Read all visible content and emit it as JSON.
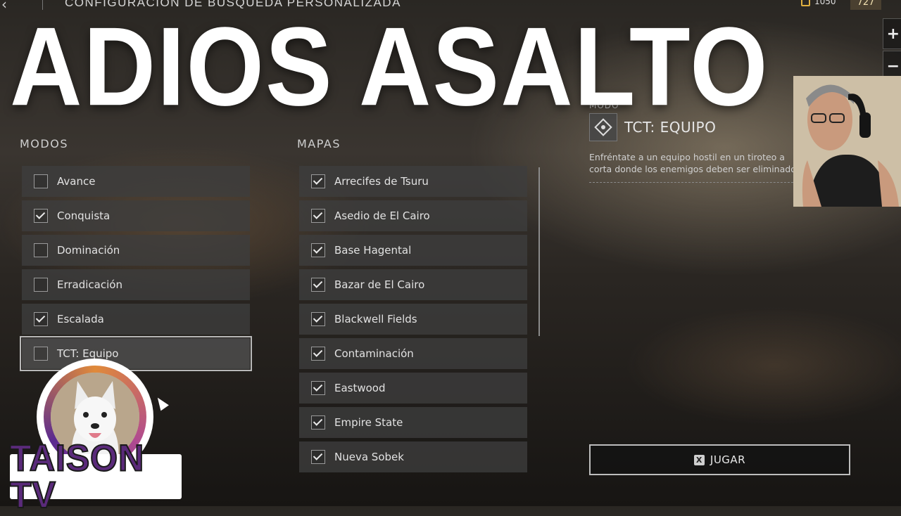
{
  "header": {
    "title": "CONFIGURACIÓN DE BÚSQUEDA PERSONALIZADA",
    "currency_value": "1050",
    "level_value": "727"
  },
  "right_rail": [
    {
      "name": "plus",
      "glyph": "+"
    },
    {
      "name": "minus",
      "glyph": "−"
    },
    {
      "name": "party",
      "glyph": "👥"
    },
    {
      "name": "exit",
      "glyph": "⇥"
    }
  ],
  "overlay": {
    "headline": "ADIOS ASALTO",
    "channel_name": "TAISON TV"
  },
  "modes": {
    "header": "MODOS",
    "items": [
      {
        "label": "Avance",
        "checked": false
      },
      {
        "label": "Conquista",
        "checked": true
      },
      {
        "label": "Dominación",
        "checked": false
      },
      {
        "label": "Erradicación",
        "checked": false
      },
      {
        "label": "Escalada",
        "checked": true
      },
      {
        "label": "TCT: Equipo",
        "checked": false,
        "selected": true
      }
    ]
  },
  "maps": {
    "header": "MAPAS",
    "items": [
      {
        "label": "Arrecifes de Tsuru",
        "checked": true
      },
      {
        "label": "Asedio de El Cairo",
        "checked": true
      },
      {
        "label": "Base Hagental",
        "checked": true
      },
      {
        "label": "Bazar de El Cairo",
        "checked": true
      },
      {
        "label": "Blackwell Fields",
        "checked": true
      },
      {
        "label": "Contaminación",
        "checked": true
      },
      {
        "label": "Eastwood",
        "checked": true
      },
      {
        "label": "Empire State",
        "checked": true
      },
      {
        "label": "Nueva Sobek",
        "checked": true
      }
    ]
  },
  "mode_detail": {
    "caption": "MODO",
    "name": "TCT: EQUIPO",
    "description": "Enfréntate a un equipo hostil en un tiroteo a corta donde los enemigos deben ser eliminados."
  },
  "play_button": {
    "key": "X",
    "label": "JUGAR"
  },
  "colors": {
    "accent_white": "#ffffff",
    "row_bg": "#3e3e3e",
    "logo_purple": "#5a2a7a",
    "logo_orange": "#e08a3a"
  }
}
